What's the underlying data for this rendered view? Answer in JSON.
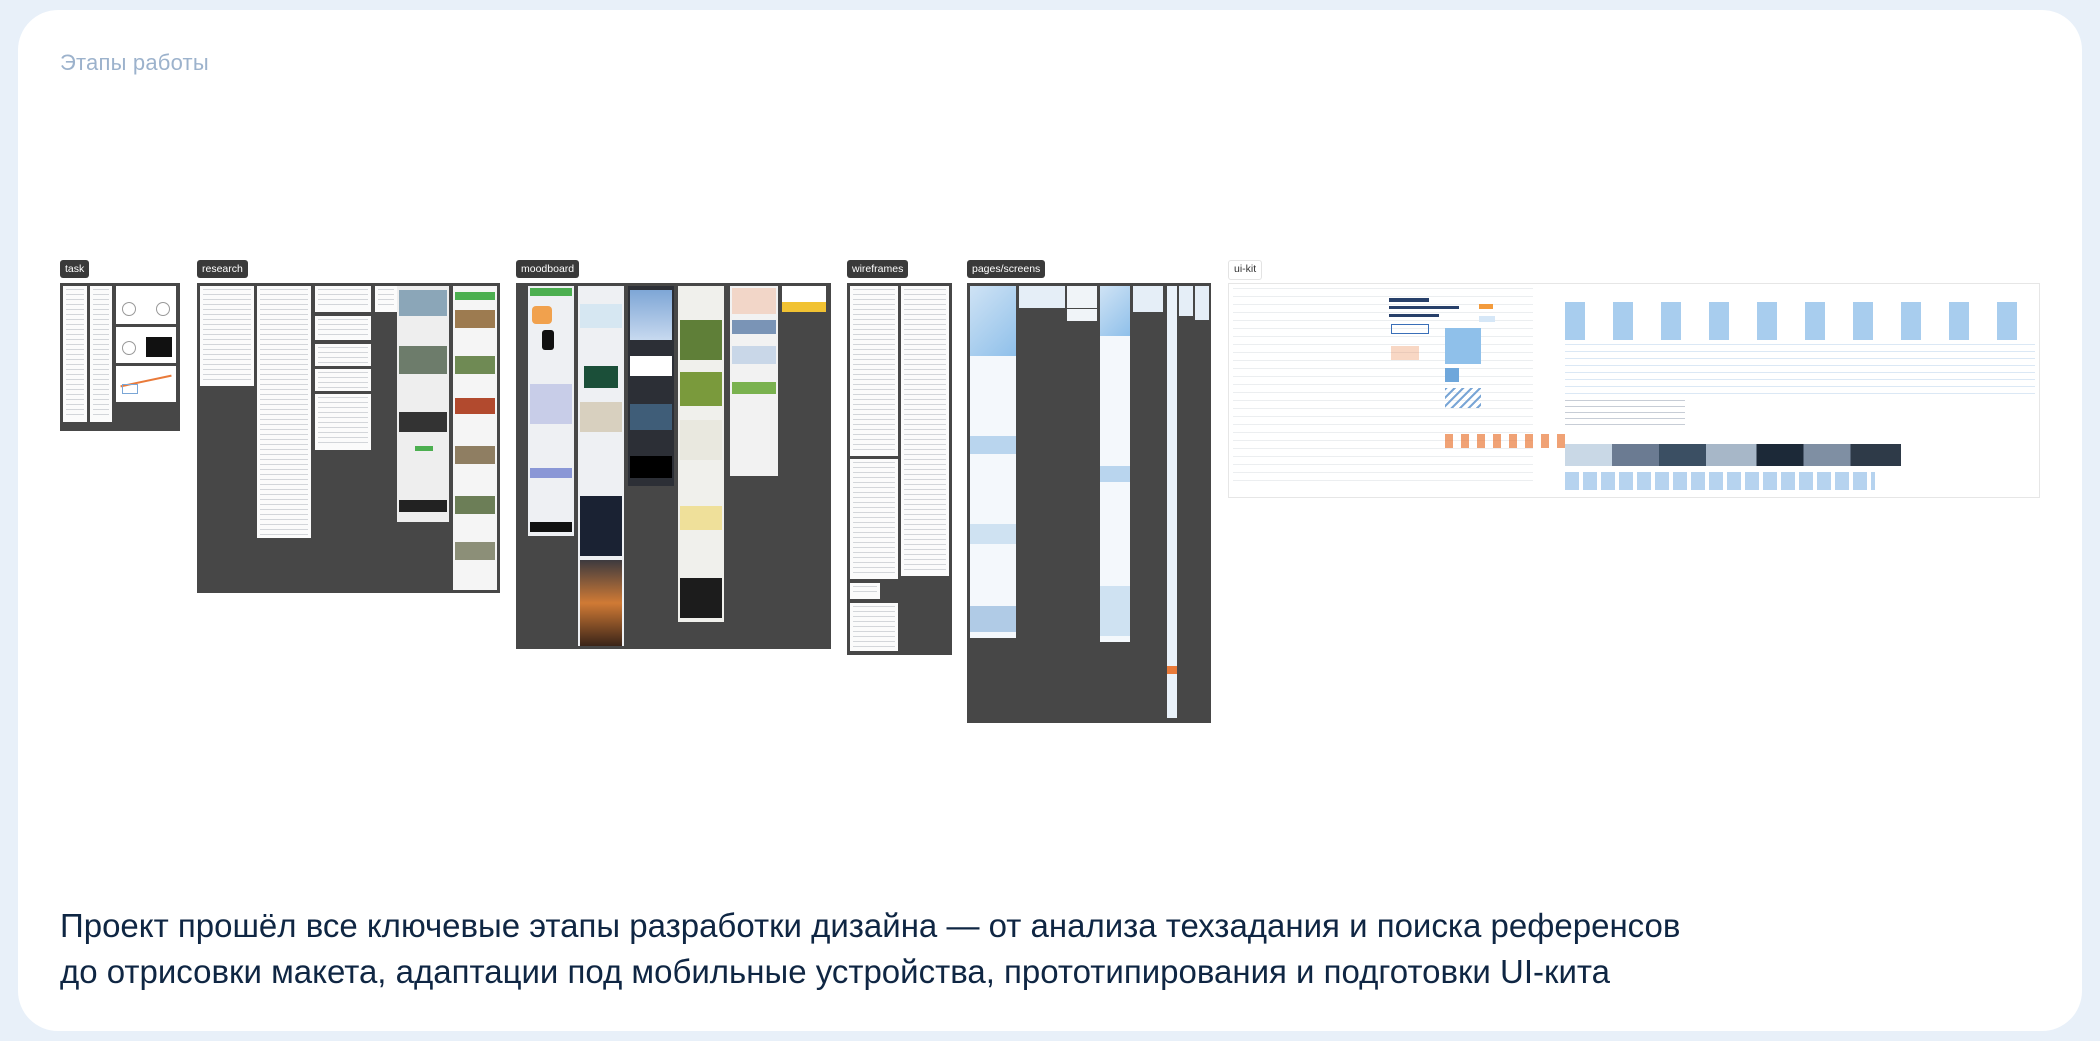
{
  "section": {
    "title": "Этапы работы"
  },
  "stages": [
    {
      "label": "task"
    },
    {
      "label": "research"
    },
    {
      "label": "moodboard"
    },
    {
      "label": "wireframes"
    },
    {
      "label": "pages/screens"
    },
    {
      "label": "ui-kit"
    }
  ],
  "caption": {
    "line1": "Проект прошёл все ключевые этапы разработки дизайна — от анализа техзадания и поиска референсов",
    "line2": "до отрисовки макета, адаптации под мобильные устройства, прототипирования и подготовки UI-кита"
  },
  "colors": {
    "page_background": "#e8f0f9",
    "card": "#ffffff",
    "eyebrow": "#9cb2cc",
    "caption": "#0f2643",
    "board_dark": "#474747",
    "accent_blue": "#8fc0ea",
    "accent_green": "#4caf50",
    "accent_orange": "#e97a3a"
  }
}
